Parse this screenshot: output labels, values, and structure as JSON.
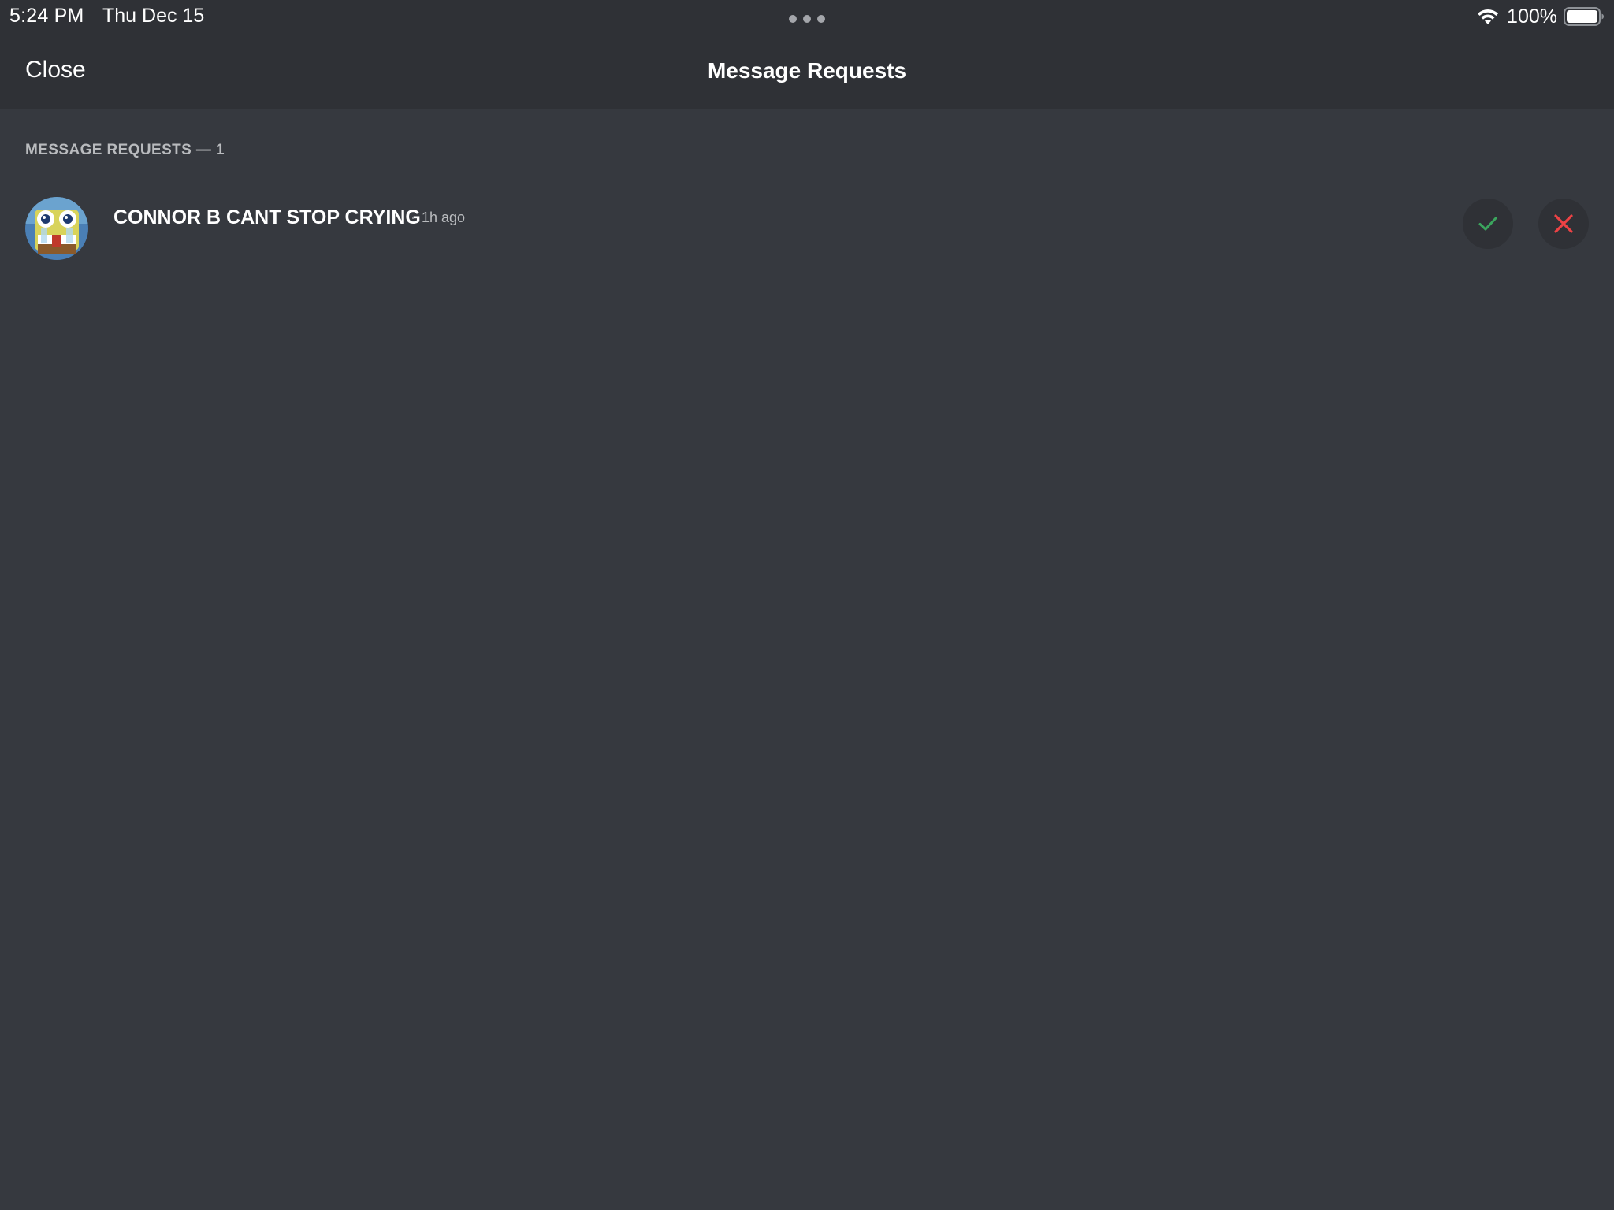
{
  "status_bar": {
    "time": "5:24 PM",
    "date": "Thu Dec 15",
    "battery_percent": "100%",
    "wifi_icon": "wifi-icon",
    "battery_icon": "battery-full-icon"
  },
  "header": {
    "close_label": "Close",
    "title": "Message Requests"
  },
  "section": {
    "header": "MESSAGE REQUESTS — 1"
  },
  "requests": [
    {
      "name": "CONNOR B CANT STOP CRYING",
      "separator": "·",
      "time_ago": "1h ago",
      "avatar_icon": "avatar-image",
      "accept_icon": "checkmark-icon",
      "decline_icon": "close-x-icon"
    }
  ],
  "colors": {
    "background": "#36393f",
    "header_background": "#2f3136",
    "accept": "#3ba55d",
    "decline": "#ed4245",
    "muted_text": "#b9bbbe"
  }
}
